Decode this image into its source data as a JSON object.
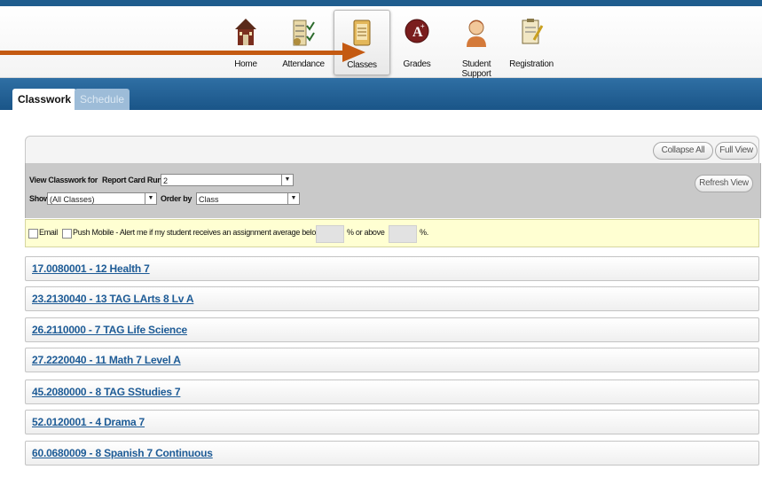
{
  "nav": {
    "items": [
      {
        "label": "Home",
        "icon": "house-icon"
      },
      {
        "label": "Attendance",
        "icon": "attendance-icon"
      },
      {
        "label": "Classes",
        "icon": "classes-icon"
      },
      {
        "label": "Grades",
        "icon": "grades-icon"
      },
      {
        "label": "Student Support",
        "icon": "student-support-icon"
      },
      {
        "label": "Registration",
        "icon": "registration-icon"
      }
    ],
    "active": "Classes"
  },
  "tabs": [
    {
      "label": "Classwork",
      "active": true
    },
    {
      "label": "Schedule",
      "active": false
    }
  ],
  "toolbar": {
    "collapse_all": "Collapse All",
    "full_view": "Full View",
    "refresh_view": "Refresh View"
  },
  "filters": {
    "view_label": "View Classwork for",
    "report_label": "Report Card Run",
    "report_value": "2",
    "show_label": "Show",
    "show_value": "(All Classes)",
    "order_label": "Order by",
    "order_value": "Class"
  },
  "alert": {
    "email_label": "Email",
    "push_label": "Push Mobile - Alert me if my student receives an assignment average below",
    "or_above": "% or above",
    "percent": "%."
  },
  "classes": [
    "17.0080001 - 12 Health 7",
    "23.2130040 - 13 TAG LArts 8 Lv A",
    "26.2110000 - 7 TAG Life Science",
    "27.2220040 - 11 Math 7 Level A",
    "45.2080000 - 8 TAG SStudies 7",
    "52.0120001 - 4 Drama 7",
    "60.0680009 - 8 Spanish 7 Continuous"
  ],
  "colors": {
    "accent": "#1f5d8e",
    "link": "#1d5b96",
    "arrow": "#c45a12",
    "alert_bg": "#ffffd2"
  }
}
